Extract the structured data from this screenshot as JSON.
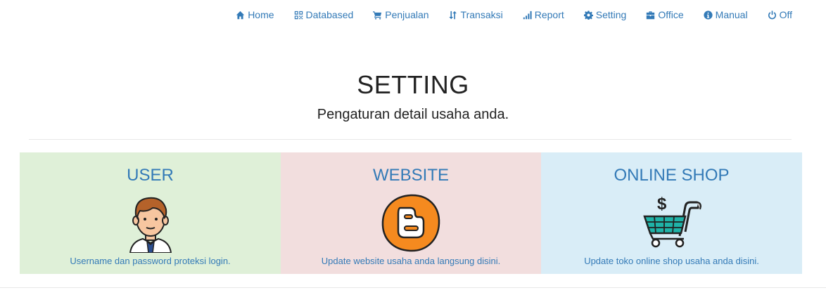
{
  "nav": {
    "items": [
      {
        "label": "Home",
        "icon": "home-icon"
      },
      {
        "label": "Databased",
        "icon": "qrcode-icon"
      },
      {
        "label": "Penjualan",
        "icon": "cart-icon"
      },
      {
        "label": "Transaksi",
        "icon": "sort-icon"
      },
      {
        "label": "Report",
        "icon": "signal-icon"
      },
      {
        "label": "Setting",
        "icon": "gear-icon"
      },
      {
        "label": "Office",
        "icon": "briefcase-icon"
      },
      {
        "label": "Manual",
        "icon": "info-icon"
      },
      {
        "label": "Off",
        "icon": "power-icon"
      }
    ]
  },
  "header": {
    "title": "SETTING",
    "subtitle": "Pengaturan detail usaha anda."
  },
  "cards": [
    {
      "title": "USER",
      "description": "Username dan password proteksi login.",
      "icon": "user-avatar-icon",
      "bg": "#dff0d8"
    },
    {
      "title": "WEBSITE",
      "description": "Update website usaha anda langsung disini.",
      "icon": "blogger-icon",
      "bg": "#f2dede"
    },
    {
      "title": "ONLINE SHOP",
      "description": "Update toko online shop usaha anda disini.",
      "icon": "shopping-cart-dollar-icon",
      "bg": "#d9edf7"
    }
  ],
  "colors": {
    "link": "#337ab7"
  }
}
